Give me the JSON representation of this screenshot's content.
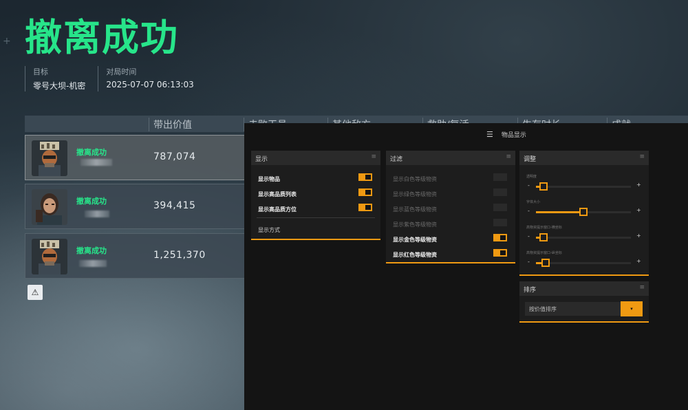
{
  "title": "撤离成功",
  "meta": {
    "target_label": "目标",
    "target_value": "零号大坝-机密",
    "time_label": "对局时间",
    "time_value": "2025-07-07 06:13:03"
  },
  "table": {
    "headers": [
      "带出价值",
      "击败干员",
      "其他敌方",
      "救助/复活",
      "生存时长",
      "成就"
    ]
  },
  "rows": [
    {
      "status": "撤离成功",
      "value": "787,074",
      "selected": true
    },
    {
      "status": "撤离成功",
      "value": "394,415",
      "selected": false
    },
    {
      "status": "撤离成功",
      "value": "1,251,370",
      "selected": false
    }
  ],
  "warning_icon": "warning-icon",
  "overlay": {
    "header_icon": "sliders-icon",
    "header_title": "物品显示",
    "display_panel": {
      "title": "显示",
      "options": [
        {
          "label": "显示物品",
          "on": true
        },
        {
          "label": "显示高品质列表",
          "on": true
        },
        {
          "label": "显示高品质方位",
          "on": true
        }
      ],
      "mode_label": "显示方式"
    },
    "filter_panel": {
      "title": "过滤",
      "options": [
        {
          "label": "显示白色等级物资",
          "on": false
        },
        {
          "label": "显示绿色等级物资",
          "on": false
        },
        {
          "label": "显示蓝色等级物资",
          "on": false
        },
        {
          "label": "显示紫色等级物资",
          "on": false
        },
        {
          "label": "显示金色等级物资",
          "on": true
        },
        {
          "label": "显示红色等级物资",
          "on": true
        }
      ]
    },
    "adjust_panel": {
      "title": "调整",
      "sliders": [
        {
          "label": "透明度",
          "fraction": 0.08
        },
        {
          "label": "字体大小",
          "fraction": 0.5
        },
        {
          "label": "高物资提示窗口-横坐标",
          "fraction": 0.08
        },
        {
          "label": "高物资提示窗口-纵坐标",
          "fraction": 0.1
        }
      ],
      "minus": "-",
      "plus": "+"
    },
    "sort_panel": {
      "title": "排序",
      "field_label": "按价值排序",
      "button_label": "▾"
    }
  },
  "colors": {
    "accent_green": "#27e58a",
    "accent_orange": "#f09a12"
  }
}
